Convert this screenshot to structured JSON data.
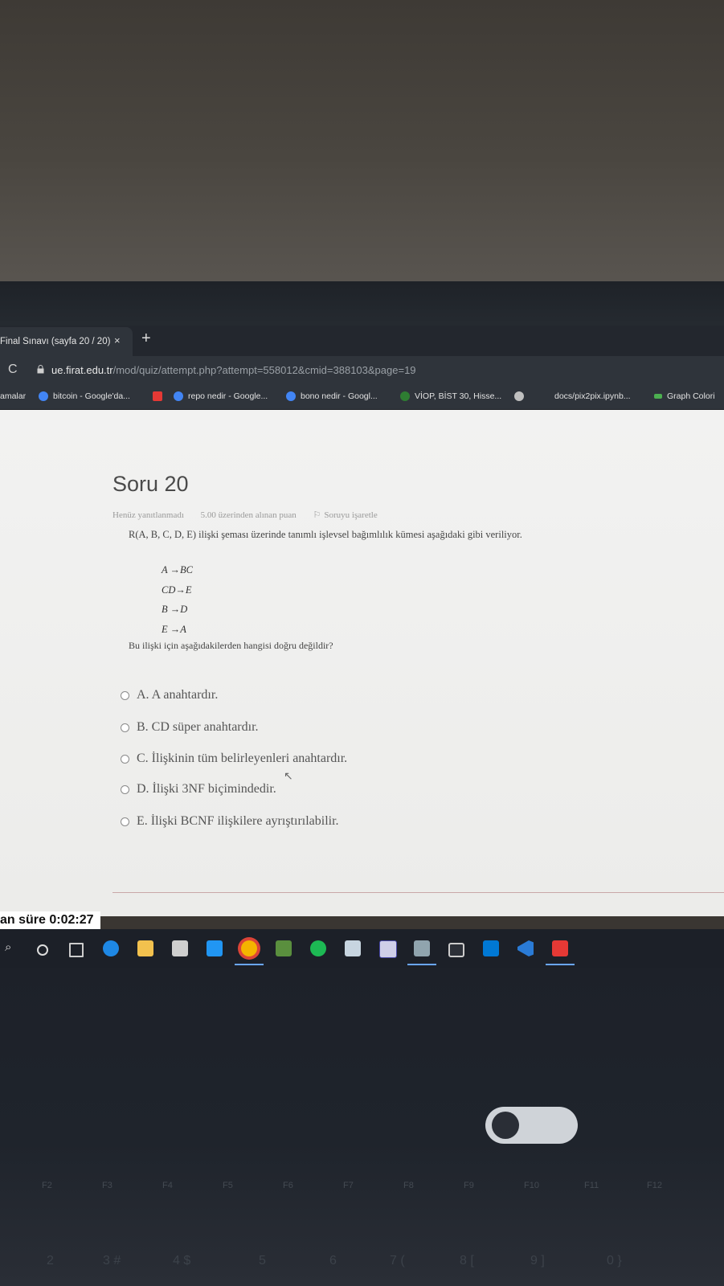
{
  "browser": {
    "tab_title": "Final Sınavı (sayfa 20 / 20)",
    "tab_close": "×",
    "new_tab": "+",
    "url_host": "ue.firat.edu.tr",
    "url_path": "/mod/quiz/attempt.php?attempt=558012&cmid=388103&page=19",
    "bookmarks": [
      {
        "label": "amalar",
        "color": ""
      },
      {
        "label": "bitcoin - Google'da...",
        "color": "#4285f4"
      },
      {
        "label": "repo nedir - Google...",
        "color": "#4285f4"
      },
      {
        "label": "bono nedir - Googl...",
        "color": "#4285f4"
      },
      {
        "label": "VİOP, BİST 30, Hisse...",
        "color": "#2e7d32"
      },
      {
        "label": "docs/pix2pix.ipynb...",
        "color": "#555555"
      },
      {
        "label": "Graph Colori",
        "color": "#4caf50"
      }
    ]
  },
  "quiz": {
    "title": "Soru 20",
    "status": "Henüz yanıtlanmadı",
    "points": "5.00 üzerinden alınan puan",
    "flag": "Soruyu işaretle",
    "question": "R(A, B, C, D, E) ilişki şeması üzerinde tanımlı işlevsel bağımlılık kümesi aşağıdaki gibi veriliyor.",
    "dependencies": [
      "A →BC",
      "CD→E",
      "B →D",
      "E →A"
    ],
    "ask": "Bu ilişki için aşağıdakilerden hangisi doğru değildir?",
    "options": [
      "A. A anahtardır.",
      "B. CD süper anahtardır.",
      "C. İlişkinin tüm belirleyenleri anahtardır.",
      "D. İlişki 3NF biçimindedir.",
      "E. İlişki BCNF ilişkilere ayrıştırılabilir."
    ],
    "timer_label": "an süre",
    "timer_value": "0:02:27"
  },
  "keyboard": {
    "fkeys": [
      "F2",
      "F3",
      "F4",
      "F5",
      "F6",
      "F7",
      "F8",
      "F9",
      "F10",
      "F11",
      "F12"
    ],
    "numkeys": [
      "2",
      "3 #",
      "4 $",
      "5",
      "6",
      "7 (",
      "8 [",
      "9 ]",
      "0 }"
    ]
  },
  "colors": {
    "accent": "#6aa6ff",
    "chrome": "#2f343b",
    "page": "#efefee"
  }
}
